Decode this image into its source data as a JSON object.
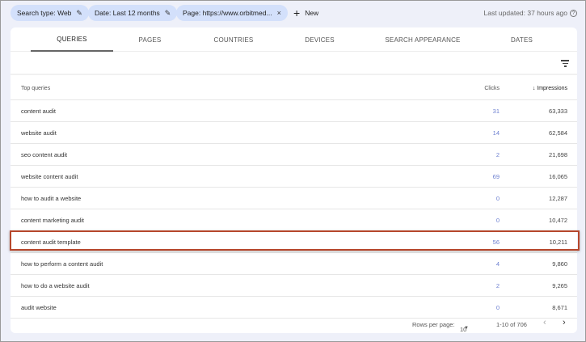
{
  "filters": [
    {
      "label": "Search type: Web",
      "icon": "pencil-icon"
    },
    {
      "label": "Date: Last 12 months",
      "icon": "pencil-icon"
    },
    {
      "label": "Page: https://www.orbitmed...",
      "icon": "close-icon"
    }
  ],
  "new_label": "New",
  "last_updated": "Last updated: 37 hours ago",
  "tabs": [
    "QUERIES",
    "PAGES",
    "COUNTRIES",
    "DEVICES",
    "SEARCH APPEARANCE",
    "DATES"
  ],
  "table": {
    "headers": {
      "query": "Top queries",
      "clicks": "Clicks",
      "impressions": "Impressions",
      "sort_arrow": "↓"
    },
    "rows": [
      {
        "query": "content audit",
        "clicks": "31",
        "impressions": "63,333"
      },
      {
        "query": "website audit",
        "clicks": "14",
        "impressions": "62,584"
      },
      {
        "query": "seo content audit",
        "clicks": "2",
        "impressions": "21,698"
      },
      {
        "query": "website content audit",
        "clicks": "69",
        "impressions": "16,065"
      },
      {
        "query": "how to audit a website",
        "clicks": "0",
        "impressions": "12,287"
      },
      {
        "query": "content marketing audit",
        "clicks": "0",
        "impressions": "10,472"
      },
      {
        "query": "content audit template",
        "clicks": "56",
        "impressions": "10,211"
      },
      {
        "query": "how to perform a content audit",
        "clicks": "4",
        "impressions": "9,860"
      },
      {
        "query": "how to do a website audit",
        "clicks": "2",
        "impressions": "9,265"
      },
      {
        "query": "audit website",
        "clicks": "0",
        "impressions": "8,671"
      }
    ],
    "highlighted_row": 6
  },
  "pager": {
    "rows_per_page_label": "Rows per page:",
    "rows_per_page": "10",
    "range": "1-10 of 706",
    "prev": "‹",
    "next": "›"
  },
  "colors": {
    "highlight": "#b6472c",
    "chip": "#d3e0fb",
    "clicks": "#6c7fd0"
  }
}
